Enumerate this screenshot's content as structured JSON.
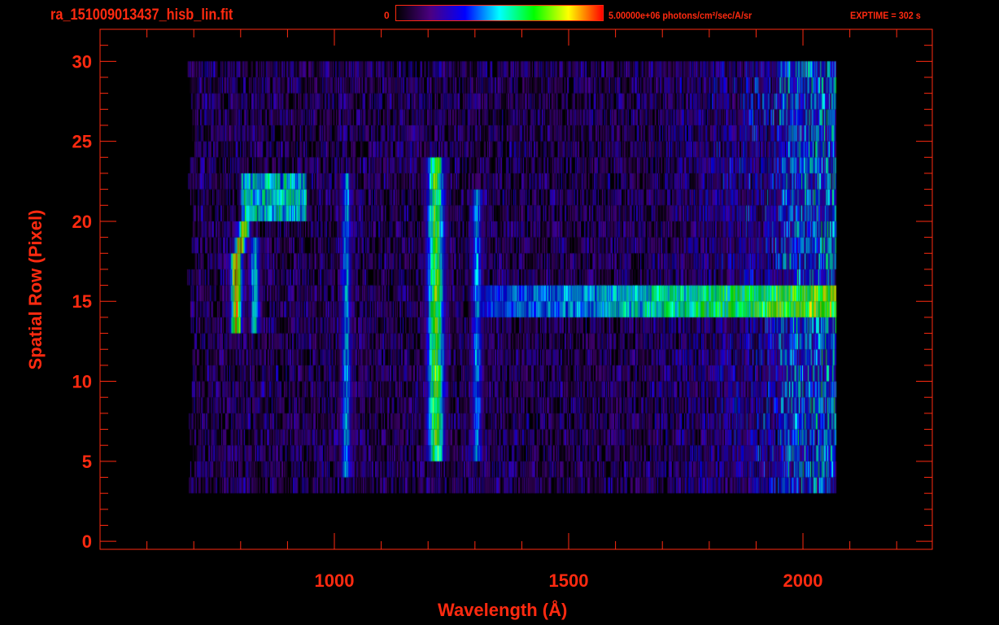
{
  "header": {
    "title": "ra_151009013437_hisb_lin.fit",
    "colorbar_min_label": "0",
    "colorbar_max_label": "5.00000e+06 photons/cm²/sec/A/sr",
    "exptime": "EXPTIME = 302 s"
  },
  "colors": {
    "axis": "#ff2a10",
    "background": "#000000",
    "colormap": [
      "#000000",
      "#4b0082",
      "#0000ff",
      "#00ffff",
      "#00ff00",
      "#ffff00",
      "#ff0000"
    ]
  },
  "chart_data": {
    "type": "heatmap",
    "title": "ra_151009013437_hisb_lin.fit",
    "xlabel": "Wavelength (Å)",
    "ylabel": "Spatial Row (Pixel)",
    "xlim": [
      500,
      2276
    ],
    "ylim": [
      -0.5,
      32
    ],
    "x_ticks": [
      1000,
      1500,
      2000
    ],
    "x_tick_labels": [
      "1000",
      "1500",
      "2000"
    ],
    "y_ticks": [
      0,
      5,
      10,
      15,
      20,
      25,
      30
    ],
    "y_tick_labels": [
      "0",
      "5",
      "10",
      "15",
      "20",
      "25",
      "30"
    ],
    "colorbar": {
      "min": 0,
      "max": 5000000,
      "units": "photons/cm²/sec/A/sr",
      "scale": "linear"
    },
    "data_extent": {
      "wavelength": [
        700,
        2070
      ],
      "rows": [
        3,
        30
      ]
    },
    "features": [
      {
        "wavelength": 790,
        "rows": [
          13,
          20
        ],
        "level": 0.9
      },
      {
        "wavelength": 830,
        "rows": [
          13,
          19
        ],
        "level": 0.5
      },
      {
        "wavelength_range": [
          800,
          940
        ],
        "rows": [
          20,
          23
        ],
        "level": 0.6
      },
      {
        "wavelength": 1025,
        "rows": [
          4,
          23
        ],
        "level": 0.45
      },
      {
        "wavelength": 1216,
        "rows": [
          5,
          24
        ],
        "level": 0.7
      },
      {
        "wavelength": 1304,
        "rows": [
          5,
          22
        ],
        "level": 0.45
      },
      {
        "wavelength_range": [
          1300,
          2070
        ],
        "rows": [
          14,
          16
        ],
        "level": 0.75
      }
    ]
  },
  "xlabel": "Wavelength (Å)",
  "ylabel": "Spatial Row (Pixel)"
}
